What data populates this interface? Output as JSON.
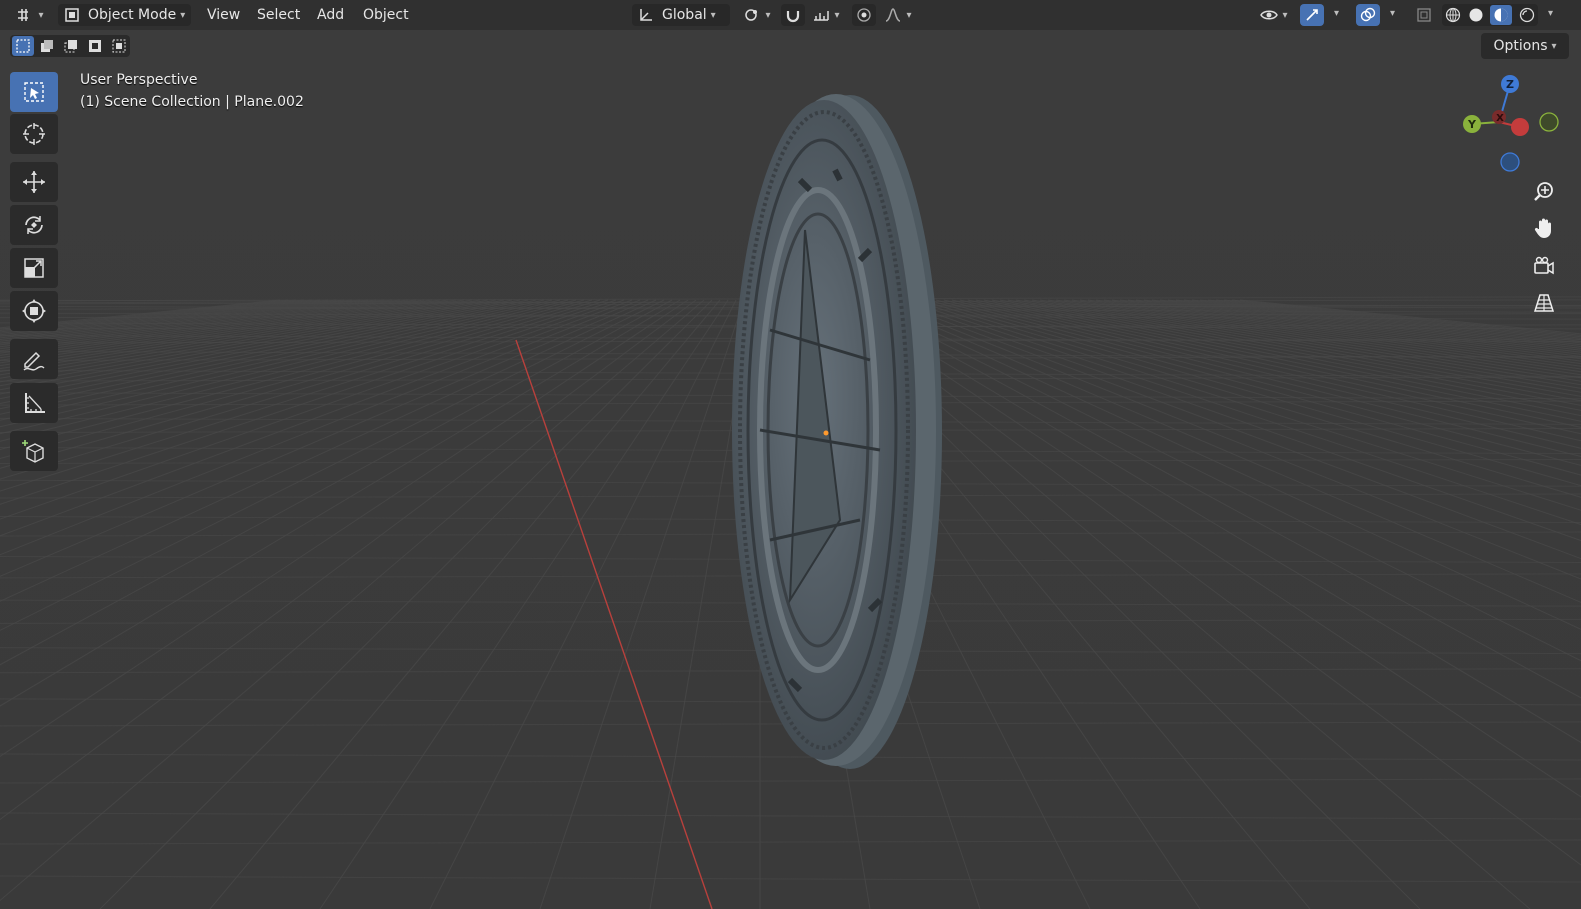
{
  "header": {
    "mode_label": "Object Mode",
    "menus": [
      "View",
      "Select",
      "Add",
      "Object"
    ],
    "transform_orientation": "Global",
    "options_label": "Options"
  },
  "viewport": {
    "view_name": "User Perspective",
    "collection_label": "(1) Scene Collection | Plane.002"
  },
  "gizmo": {
    "z": "Z",
    "y": "Y",
    "x": "X"
  },
  "colors": {
    "header_bg": "#303030",
    "viewport_bg": "#3d3d3d",
    "accent": "#4772b3",
    "x_axis": "#c43c3c",
    "y_axis": "#8ab23c",
    "z_axis": "#3f7ad6"
  },
  "icons": {
    "tools": [
      "select-box-icon",
      "cursor-icon",
      "move-icon",
      "rotate-icon",
      "scale-icon",
      "transform-icon",
      "annotate-icon",
      "measure-icon",
      "add-cube-icon"
    ],
    "nav": [
      "zoom-icon",
      "pan-hand-icon",
      "camera-icon",
      "grid-view-icon"
    ]
  }
}
